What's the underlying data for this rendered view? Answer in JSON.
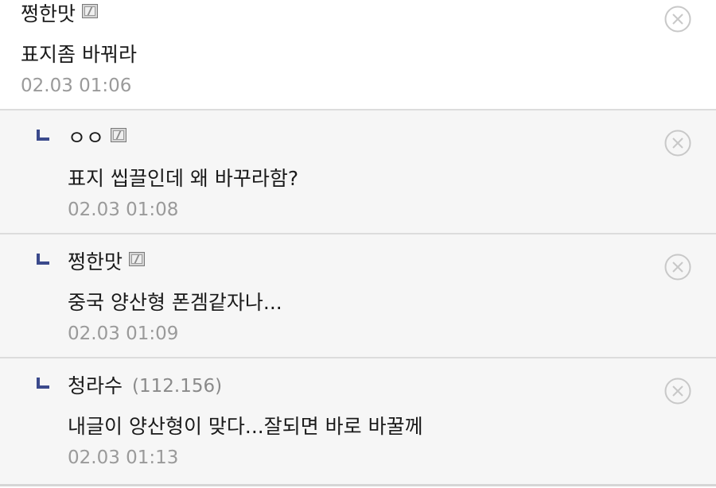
{
  "comments": [
    {
      "nick": "쩡한맛",
      "ip": "",
      "text": "표지좀 바꿔라",
      "time": "02.03 01:06"
    },
    {
      "nick": "ㅇㅇ",
      "ip": "",
      "text": "표지 씹끌인데 왜 바꾸라함?",
      "time": "02.03 01:08"
    },
    {
      "nick": "쩡한맛",
      "ip": "",
      "text": "중국 양산형 폰겜같자나...",
      "time": "02.03 01:09"
    },
    {
      "nick": "청라수",
      "ip": "(112.156)",
      "text": "내글이 양산형이 맞다...잘되면 바로 바꿀께",
      "time": "02.03 01:13"
    }
  ],
  "icons": {
    "member": "member-badge-icon",
    "delete": "delete-circle-x-icon",
    "reply": "reply-arrow-icon"
  },
  "colors": {
    "reply_arrow": "#3b4a8c",
    "reply_bg": "#f6f6f6",
    "time_text": "#9a9a9a",
    "delete_icon": "#c8c8c8"
  }
}
